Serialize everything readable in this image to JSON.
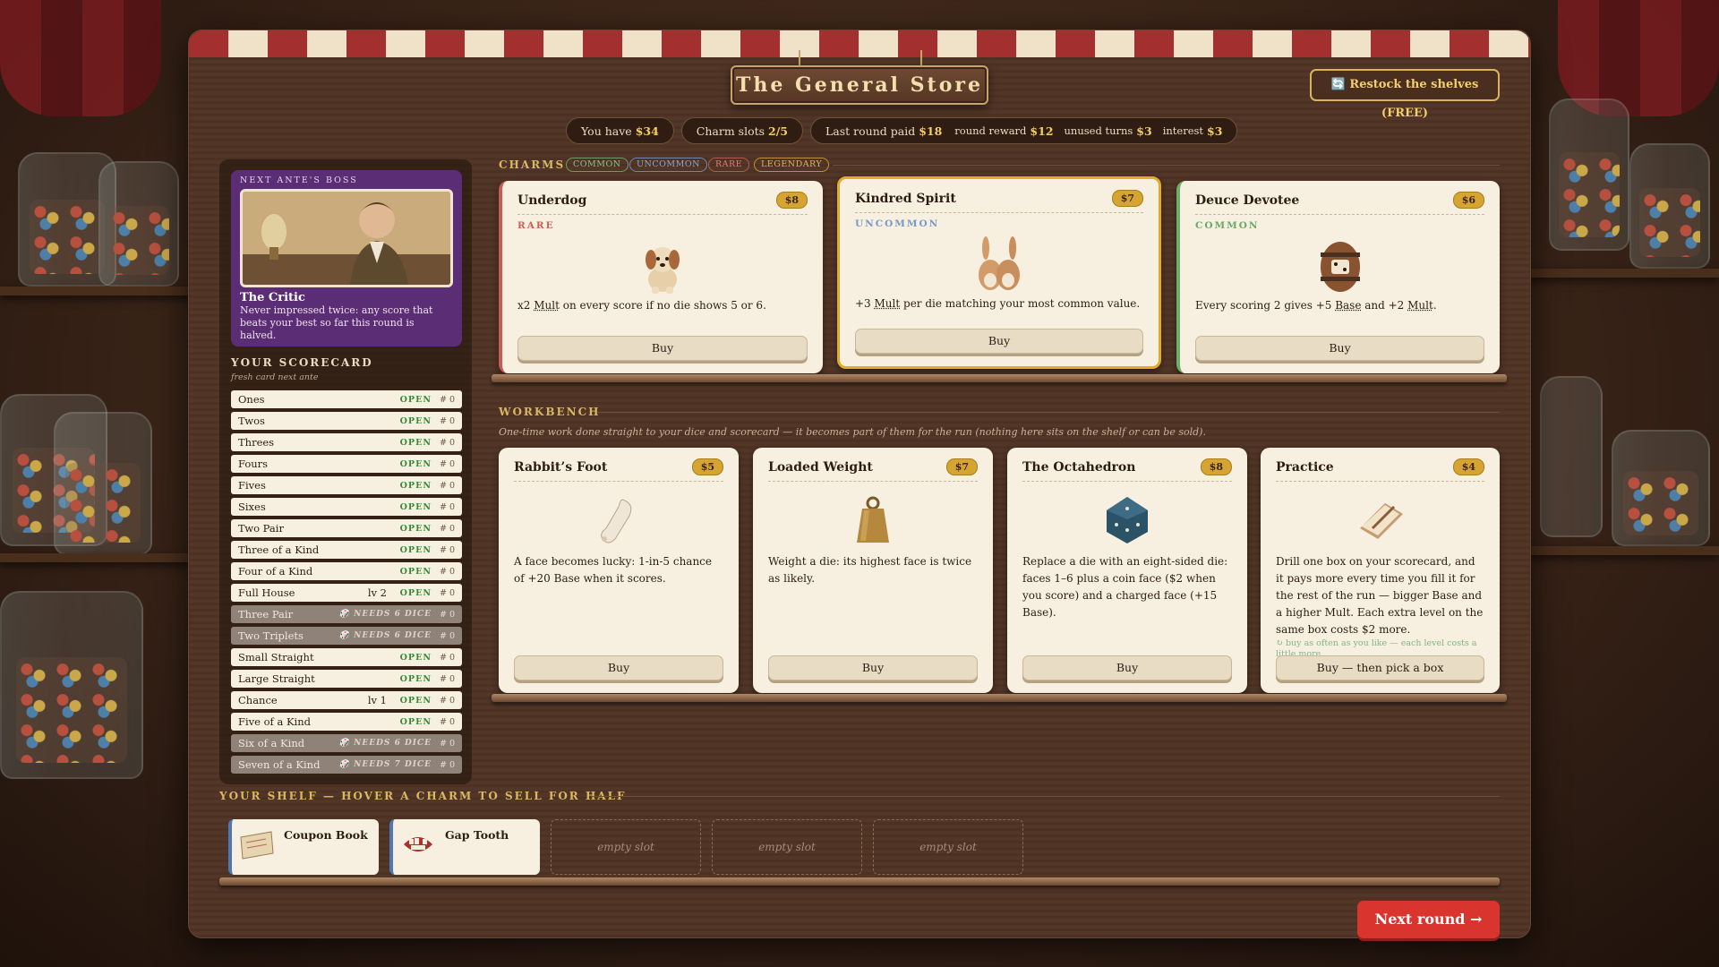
{
  "title": "The General Store",
  "restock_label": "🔄 Restock the shelves (FREE)",
  "stats": {
    "money_label": "You have",
    "money": "$34",
    "slots_label": "Charm slots",
    "slots": "2/5",
    "last_round_label": "Last round paid",
    "last_round": "$18",
    "reward_label": "round reward",
    "reward": "$12",
    "turns_label": "unused turns",
    "turns": "$3",
    "interest_label": "interest",
    "interest": "$3"
  },
  "boss": {
    "label": "NEXT ANTE'S BOSS",
    "name": "The Critic",
    "desc": "Never impressed twice: any score that beats your best so far this round is halved."
  },
  "scorecard": {
    "title": "YOUR SCORECARD",
    "subtitle": "fresh card next ante",
    "rows": [
      {
        "name": "Ones",
        "level": "",
        "status": "OPEN",
        "count": "# 0",
        "locked": false
      },
      {
        "name": "Twos",
        "level": "",
        "status": "OPEN",
        "count": "# 0",
        "locked": false
      },
      {
        "name": "Threes",
        "level": "",
        "status": "OPEN",
        "count": "# 0",
        "locked": false
      },
      {
        "name": "Fours",
        "level": "",
        "status": "OPEN",
        "count": "# 0",
        "locked": false
      },
      {
        "name": "Fives",
        "level": "",
        "status": "OPEN",
        "count": "# 0",
        "locked": false
      },
      {
        "name": "Sixes",
        "level": "",
        "status": "OPEN",
        "count": "# 0",
        "locked": false
      },
      {
        "name": "Two Pair",
        "level": "",
        "status": "OPEN",
        "count": "# 0",
        "locked": false
      },
      {
        "name": "Three of a Kind",
        "level": "",
        "status": "OPEN",
        "count": "# 0",
        "locked": false
      },
      {
        "name": "Four of a Kind",
        "level": "",
        "status": "OPEN",
        "count": "# 0",
        "locked": false
      },
      {
        "name": "Full House",
        "level": "lv 2",
        "status": "OPEN",
        "count": "# 0",
        "locked": false
      },
      {
        "name": "Three Pair",
        "level": "",
        "status": "🎲 NEEDS 6 DICE",
        "count": "# 0",
        "locked": true
      },
      {
        "name": "Two Triplets",
        "level": "",
        "status": "🎲 NEEDS 6 DICE",
        "count": "# 0",
        "locked": true
      },
      {
        "name": "Small Straight",
        "level": "",
        "status": "OPEN",
        "count": "# 0",
        "locked": false
      },
      {
        "name": "Large Straight",
        "level": "",
        "status": "OPEN",
        "count": "# 0",
        "locked": false
      },
      {
        "name": "Chance",
        "level": "lv 1",
        "status": "OPEN",
        "count": "# 0",
        "locked": false
      },
      {
        "name": "Five of a Kind",
        "level": "",
        "status": "OPEN",
        "count": "# 0",
        "locked": false
      },
      {
        "name": "Six of a Kind",
        "level": "",
        "status": "🎲 NEEDS 6 DICE",
        "count": "# 0",
        "locked": true
      },
      {
        "name": "Seven of a Kind",
        "level": "",
        "status": "🎲 NEEDS 7 DICE",
        "count": "# 0",
        "locked": true
      }
    ]
  },
  "charms": {
    "heading": "CHARMS",
    "tags": [
      "COMMON",
      "UNCOMMON",
      "RARE",
      "LEGENDARY"
    ],
    "items": [
      {
        "name": "Underdog",
        "price": "$8",
        "rarity": "RARE",
        "desc_a": "x2 ",
        "desc_b": "Mult",
        "desc_c": " on every score if no die shows 5 or 6.",
        "buy": "Buy",
        "icon": "dog-icon"
      },
      {
        "name": "Kindred Spirit",
        "price": "$7",
        "rarity": "UNCOMMON",
        "desc_a": "+3 ",
        "desc_b": "Mult",
        "desc_c": " per die matching your most common value.",
        "buy": "Buy",
        "icon": "twin-rabbits-icon"
      },
      {
        "name": "Deuce Devotee",
        "price": "$6",
        "rarity": "COMMON",
        "desc_a": "Every scoring 2 gives +5 ",
        "desc_b": "Base",
        "desc_c": " and +2 ",
        "desc_d": "Mult",
        "desc_e": ".",
        "buy": "Buy",
        "icon": "barrel-icon"
      }
    ]
  },
  "workbench": {
    "heading": "WORKBENCH",
    "subtitle": "One-time work done straight to your dice and scorecard — it becomes part of them for the run (nothing here sits on the shelf or can be sold).",
    "items": [
      {
        "name": "Rabbit’s Foot",
        "price": "$5",
        "desc": "A face becomes lucky: 1-in-5 chance of +20 Base when it scores.",
        "buy": "Buy",
        "icon": "rabbit-foot-icon",
        "note": ""
      },
      {
        "name": "Loaded Weight",
        "price": "$7",
        "desc": "Weight a die: its highest face is twice as likely.",
        "buy": "Buy",
        "icon": "weight-icon",
        "note": ""
      },
      {
        "name": "The Octahedron",
        "price": "$8",
        "desc": "Replace a die with an eight-sided die: faces 1–6 plus a coin face ($2 when you score) and a charged face (+15 Base).",
        "buy": "Buy",
        "icon": "octahedron-die-icon",
        "note": ""
      },
      {
        "name": "Practice",
        "price": "$4",
        "desc": "Drill one box on your scorecard, and it pays more every time you fill it for the rest of the run — bigger Base and a higher Mult. Each extra level on the same box costs $2 more.",
        "buy": "Buy — then pick a box",
        "icon": "practice-book-icon",
        "note": "↻ buy as often as you like — each level costs a little more"
      }
    ]
  },
  "shelf": {
    "heading": "YOUR SHELF — HOVER A CHARM TO SELL FOR HALF",
    "items": [
      {
        "name": "Coupon Book",
        "icon": "coupon-book-icon"
      },
      {
        "name": "Gap Tooth",
        "icon": "gap-tooth-icon"
      }
    ],
    "empty_label": "empty slot"
  },
  "next_round": "Next round →"
}
